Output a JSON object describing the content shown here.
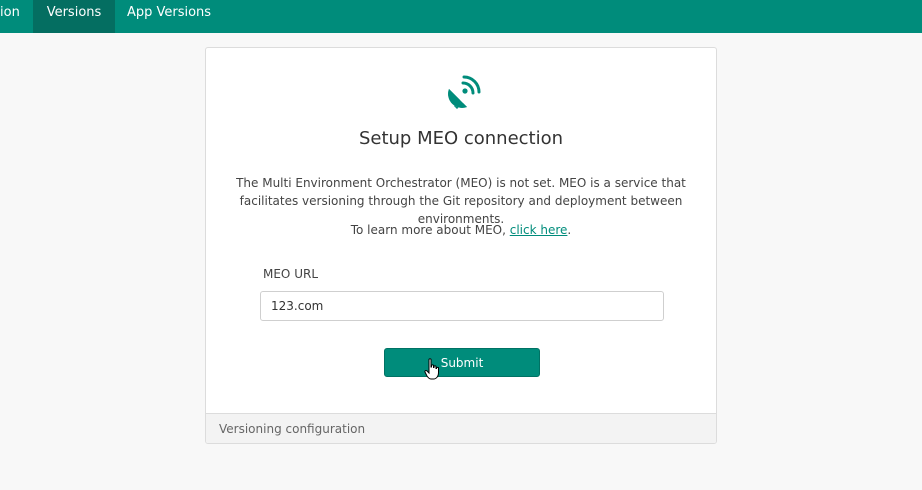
{
  "nav": {
    "tabs": [
      {
        "label": "ion"
      },
      {
        "label": "Versions",
        "active": true
      },
      {
        "label": "App Versions"
      }
    ]
  },
  "card": {
    "icon": "satellite-dish-icon",
    "title": "Setup MEO connection",
    "description": "The Multi Environment Orchestrator (MEO) is not set. MEO is a service that facilitates versioning through the Git repository and deployment between environments.",
    "learn_prefix": "To learn more about MEO, ",
    "learn_link": "click here",
    "learn_suffix": ".",
    "url_label": "MEO URL",
    "url_value": "123.com",
    "submit_label": "Submit",
    "footer": "Versioning configuration"
  },
  "colors": {
    "brand": "#008c7b",
    "active_tab": "#046e61"
  }
}
